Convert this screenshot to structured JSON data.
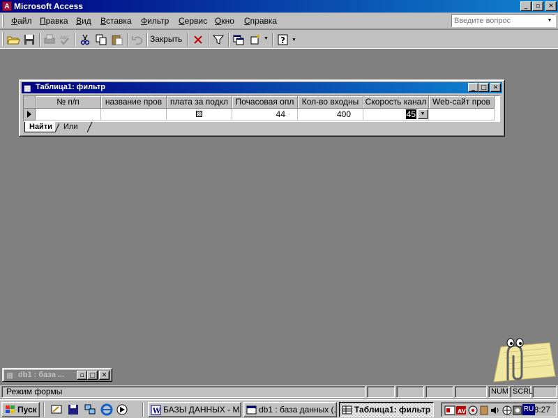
{
  "app": {
    "title": "Microsoft Access",
    "icon_letter": "A"
  },
  "menu": {
    "items": [
      "Файл",
      "Правка",
      "Вид",
      "Вставка",
      "Фильтр",
      "Сервис",
      "Окно",
      "Справка"
    ],
    "help_placeholder": "Введите вопрос"
  },
  "toolbar": {
    "close_label": "Закрыть",
    "icons": [
      "open-folder-icon",
      "save-icon",
      "print-icon",
      "spelling-icon",
      "cut-icon",
      "copy-icon",
      "paste-icon",
      "undo-icon",
      "delete-icon",
      "filter-icon",
      "window-icon",
      "new-object-icon",
      "help-icon"
    ]
  },
  "child_window": {
    "title": "Таблица1: фильтр",
    "columns": [
      "№ п/п",
      "название пров",
      "плата за подкл",
      "Почасовая опл",
      "Кол-во входны",
      "Скорость канал",
      "Web-сайт пров"
    ],
    "row": {
      "num": "",
      "name": "",
      "fee_checked": true,
      "hourly": "44",
      "lines": "400",
      "speed": "45",
      "web": ""
    },
    "tabs": [
      "Найти",
      "Или"
    ]
  },
  "db_window": {
    "title": "db1 : база ..."
  },
  "statusbar": {
    "text": "Режим формы",
    "num": "NUM",
    "scrl": "SCRL"
  },
  "taskbar": {
    "start_label": "Пуск",
    "tasks": [
      {
        "label": "БАЗЫ ДАННЫХ - M...",
        "icon": "word-icon",
        "active": false
      },
      {
        "label": "db1 : база данных (...",
        "icon": "access-db-icon",
        "active": false
      },
      {
        "label": "Таблица1: фильтр",
        "icon": "table-icon",
        "active": true
      }
    ],
    "lang": "RU",
    "clock": "8:27"
  },
  "colors": {
    "titlebar_start": "#000080",
    "titlebar_end": "#1084d0",
    "face": "#c0c0c0",
    "mdi_bg": "#808080"
  }
}
